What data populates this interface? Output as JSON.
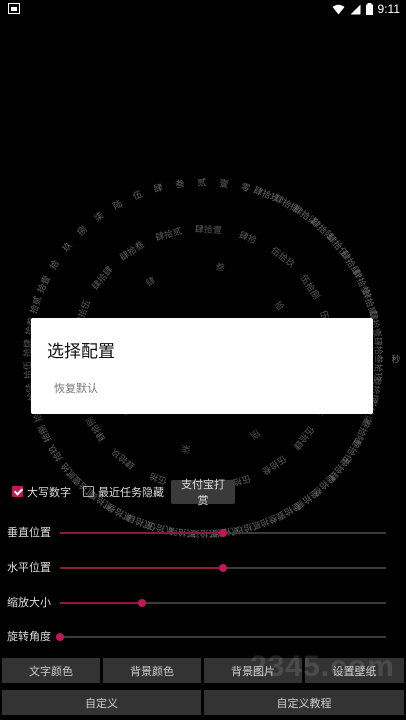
{
  "status_bar": {
    "time": "9:11"
  },
  "clock_text": {
    "seconds_words": [
      "肆拾玖",
      "肆拾捌",
      "肆拾柒",
      "肆拾陆",
      "肆拾伍",
      "肆拾肆",
      "肆拾叁",
      "肆拾贰",
      "肆拾壹",
      "肆拾",
      "叁拾玖",
      "叁拾捌",
      "叁拾柒",
      "叁拾陆",
      "叁拾伍",
      "叁拾肆",
      "叁拾叁",
      "叁拾贰",
      "叁拾壹",
      "叁拾",
      "贰拾玖",
      "贰拾捌",
      "贰拾柒",
      "贰拾陆",
      "贰拾伍",
      "贰拾肆",
      "贰拾叁",
      "贰拾贰",
      "贰拾壹",
      "贰拾",
      "拾玖",
      "拾捌",
      "拾柒",
      "拾陆",
      "拾伍",
      "拾肆",
      "拾叁",
      "拾贰",
      "拾壹",
      "拾",
      "玖",
      "捌",
      "柒",
      "陆",
      "伍",
      "肆",
      "叁",
      "贰",
      "壹",
      "零"
    ],
    "minutes_words": [
      "伍拾玖",
      "伍拾捌",
      "伍拾柒",
      "伍拾陆",
      "伍拾伍",
      "伍拾肆",
      "伍拾叁",
      "伍拾贰",
      "伍拾壹",
      "伍拾",
      "肆拾玖",
      "肆拾捌",
      "肆拾柒",
      "肆拾陆",
      "肆拾伍",
      "肆拾肆",
      "肆拾叁",
      "肆拾贰",
      "肆拾壹",
      "肆拾"
    ],
    "hours_words": [
      "拾",
      "玖",
      "捌",
      "柒",
      "陆",
      "伍",
      "肆",
      "叁"
    ],
    "seconds_unit": "秒"
  },
  "dialog": {
    "title": "选择配置",
    "items": [
      "恢复默认"
    ]
  },
  "options": {
    "uppercase_digits": {
      "label": "大写数字",
      "checked": true
    },
    "hide_recent_tasks": {
      "label": "最近任务隐藏",
      "checked": false
    },
    "alipay_button": "支付宝打赏"
  },
  "sliders": [
    {
      "label": "垂直位置",
      "value": 0.5
    },
    {
      "label": "水平位置",
      "value": 0.5
    },
    {
      "label": "缩放大小",
      "value": 0.25
    },
    {
      "label": "旋转角度",
      "value": 0.0
    }
  ],
  "buttons_row1": [
    "文字颜色",
    "背景颜色",
    "背景图片",
    "设置壁纸"
  ],
  "buttons_row2": [
    "自定义",
    "自定义教程"
  ],
  "watermark": "2345.com",
  "colors": {
    "accent": "#c2185b",
    "track_fill": "#8a1843",
    "button_bg": "#333333"
  }
}
